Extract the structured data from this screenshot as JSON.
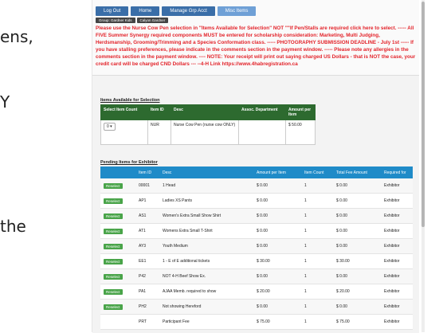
{
  "side_text": [
    "ens,",
    "Y",
    "the"
  ],
  "nav": [
    "Log Out",
    "Home",
    "Manage Grp Acct",
    "Misc Items"
  ],
  "pills": [
    "Group: Gardner Kids",
    "Calyon Gardner"
  ],
  "notice": "Please use the Nurse Cow Pen selection in \"Items Available for Selection\" NOT \"\"If Pen/Stalls are required click here to select. ----- All FIVE Summer Synergy required components MUST be entered for scholarship consideration: Marketing, Multi Judging, Herdsmanship, Grooming/Trimming and a Species Conformation class. ----- PHOTOGRAPHY SUBMISSION DEADLINE - July 1st ----- If you have stalling preferences, please indicate in the comments section in the payment window. ----- Please note any allergies in the comments section in the payment window. ---- NOTE: Your receipt will print out saying charged US Dollars - that is NOT the case, your credit card will be charged CND Dollars --- --4-H Link https://www.4habregistration.ca",
  "available": {
    "title": "Items Available for Selection",
    "headers": [
      "Select Item Count",
      "Item ID",
      "Desc",
      "Assoc. Department",
      "Amount per Item"
    ],
    "rows": [
      {
        "count": "0",
        "id": "NUR",
        "desc": "Nurse Cow Pen (nurse cow ONLY)",
        "dept": "",
        "amount": "$ 50.00"
      }
    ]
  },
  "pending": {
    "title": "Pending Items for Exhibitor",
    "headers": [
      "",
      "Item ID",
      "Desc",
      "Amount per Item",
      "Item Count",
      "Total Fee Amount",
      "Required for"
    ],
    "button_label": "Reselect",
    "rows": [
      {
        "id": "00001",
        "desc": "1 Head",
        "amount": "$ 0.00",
        "count": "1",
        "total": "$ 0.00",
        "req": "Exhibitor",
        "btn": true
      },
      {
        "id": "AP1",
        "desc": "Ladies XS Pants",
        "amount": "$ 0.00",
        "count": "1",
        "total": "$ 0.00",
        "req": "Exhibitor",
        "btn": true
      },
      {
        "id": "AS1",
        "desc": "Women's Extra Small Show Shirt",
        "amount": "$ 0.00",
        "count": "1",
        "total": "$ 0.00",
        "req": "Exhibitor",
        "btn": true
      },
      {
        "id": "AT1",
        "desc": "Womens Extra Small T-Shirt",
        "amount": "$ 0.00",
        "count": "1",
        "total": "$ 0.00",
        "req": "Exhibitor",
        "btn": true
      },
      {
        "id": "AY3",
        "desc": "Youth Medium",
        "amount": "$ 0.00",
        "count": "1",
        "total": "$ 0.00",
        "req": "Exhibitor",
        "btn": true
      },
      {
        "id": "EE1",
        "desc": "1 - E of E additional tickets",
        "amount": "$ 30.00",
        "count": "1",
        "total": "$ 30.00",
        "req": "Exhibitor",
        "btn": true
      },
      {
        "id": "P42",
        "desc": "NOT 4-H Beef Show Ex.",
        "amount": "$ 0.00",
        "count": "1",
        "total": "$ 0.00",
        "req": "Exhibitor",
        "btn": true
      },
      {
        "id": "PA1",
        "desc": "AJAA Memb. required to show",
        "amount": "$ 20.00",
        "count": "1",
        "total": "$ 20.00",
        "req": "Exhibitor",
        "btn": true
      },
      {
        "id": "PH2",
        "desc": "Not showing Hereford",
        "amount": "$ 0.00",
        "count": "1",
        "total": "$ 0.00",
        "req": "Exhibitor",
        "btn": true
      },
      {
        "id": "PRT",
        "desc": "Participant Fee",
        "amount": "$ 75.00",
        "count": "1",
        "total": "$ 75.00",
        "req": "Exhibitor",
        "btn": false
      }
    ]
  }
}
